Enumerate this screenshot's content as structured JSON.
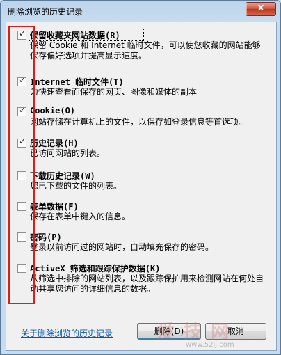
{
  "window": {
    "title": "删除浏览的历史记录",
    "close_glyph": "x"
  },
  "options": [
    {
      "checked": true,
      "title": "保留收藏夹网站数据(R)",
      "desc": "保留 Cookie 和 Internet 临时文件，可以使您收藏的网站能够保存偏好选项并提高显示速度。"
    },
    {
      "checked": true,
      "title": "Internet 临时文件(T)",
      "desc": "为快速查看而保存的网页、图像和媒体的副本"
    },
    {
      "checked": true,
      "title": "Cookie(O)",
      "desc": "网站存储在计算机上的文件，以保存如登录信息等首选项。"
    },
    {
      "checked": true,
      "title": "历史记录(H)",
      "desc": "已访问网站的列表。"
    },
    {
      "checked": false,
      "title": "下载历史记录(W)",
      "desc": "您已下载的文件的列表。"
    },
    {
      "checked": false,
      "title": "表单数据(F)",
      "desc": "保存在表单中键入的信息。"
    },
    {
      "checked": false,
      "title": "密码(P)",
      "desc": "登录以前访问过的网站时，自动填充保存的密码。"
    },
    {
      "checked": false,
      "title": "ActiveX 筛选和跟踪保护数据(K)",
      "desc": "从筛选中排除的网站列表，以及跟踪保护用来检测网站在何处自动共享您访问的详细信息的数据。"
    }
  ],
  "footer": {
    "link": "关于删除浏览的历史记录",
    "delete_button": "删除(D)",
    "cancel_button": "取消"
  },
  "watermark": {
    "text": "爱 技 网",
    "url": "www.52ij.com"
  },
  "colors": {
    "annotation_box": "#e01b1b",
    "link": "#0b57a8"
  }
}
